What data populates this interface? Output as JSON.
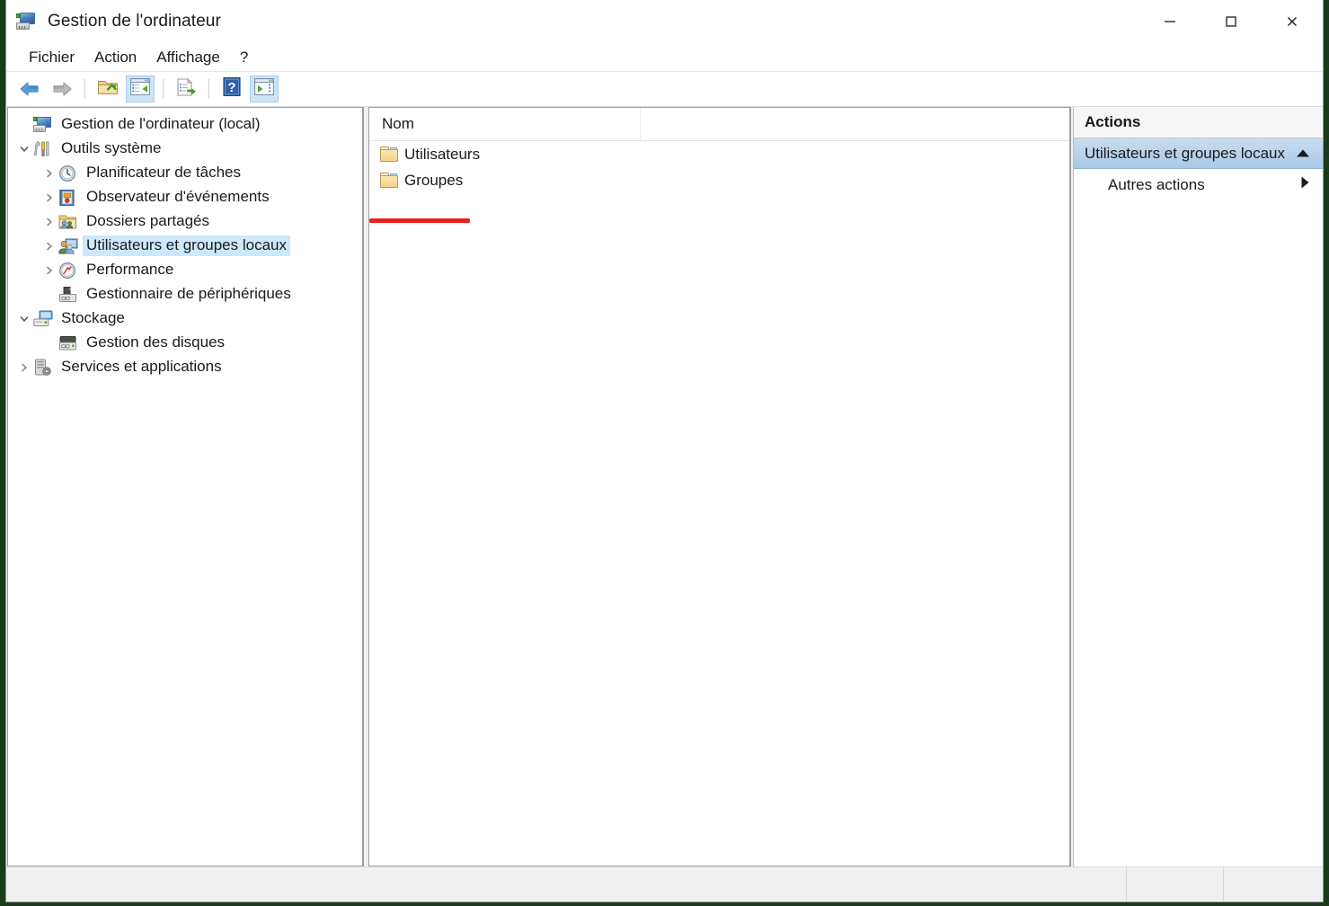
{
  "window": {
    "title": "Gestion de l'ordinateur",
    "icon": "computer-management-icon",
    "controls": {
      "minimize": "Réduire",
      "maximize": "Agrandir",
      "close": "Fermer"
    }
  },
  "menubar": {
    "items": [
      {
        "label": "Fichier",
        "name": "menu-fichier"
      },
      {
        "label": "Action",
        "name": "menu-action"
      },
      {
        "label": "Affichage",
        "name": "menu-affichage"
      },
      {
        "label": "?",
        "name": "menu-aide"
      }
    ]
  },
  "toolbar": {
    "buttons": [
      {
        "name": "back-button",
        "icon": "back-arrow-icon",
        "active": false
      },
      {
        "name": "forward-button",
        "icon": "forward-arrow-icon",
        "active": false
      },
      {
        "name": "up-one-level-button",
        "icon": "folder-up-icon",
        "active": false
      },
      {
        "name": "show-hide-console-tree-button",
        "icon": "console-tree-icon",
        "active": true
      },
      {
        "name": "export-list-button",
        "icon": "export-list-icon",
        "active": false
      },
      {
        "name": "help-button",
        "icon": "help-question-icon",
        "active": false
      },
      {
        "name": "show-hide-action-pane-button",
        "icon": "action-pane-icon",
        "active": true
      }
    ]
  },
  "tree": {
    "items": [
      {
        "label": "Gestion de l'ordinateur (local)",
        "icon": "computer-icon",
        "level": 0,
        "twisty": "none",
        "selected": false
      },
      {
        "label": "Outils système",
        "icon": "system-tools-icon",
        "level": 1,
        "twisty": "expanded",
        "selected": false
      },
      {
        "label": "Planificateur de tâches",
        "icon": "clock-icon",
        "level": 2,
        "twisty": "collapsed",
        "selected": false
      },
      {
        "label": "Observateur d'événements",
        "icon": "event-viewer-icon",
        "level": 2,
        "twisty": "collapsed",
        "selected": false
      },
      {
        "label": "Dossiers partagés",
        "icon": "shared-folders-icon",
        "level": 2,
        "twisty": "collapsed",
        "selected": false
      },
      {
        "label": "Utilisateurs et groupes locaux",
        "icon": "local-users-groups-icon",
        "level": 2,
        "twisty": "collapsed",
        "selected": true
      },
      {
        "label": "Performance",
        "icon": "performance-icon",
        "level": 2,
        "twisty": "collapsed",
        "selected": false
      },
      {
        "label": "Gestionnaire de périphériques",
        "icon": "device-manager-icon",
        "level": 2,
        "twisty": "none",
        "selected": false
      },
      {
        "label": "Stockage",
        "icon": "storage-icon",
        "level": 1,
        "twisty": "expanded",
        "selected": false
      },
      {
        "label": "Gestion des disques",
        "icon": "disk-management-icon",
        "level": 2,
        "twisty": "none",
        "selected": false
      },
      {
        "label": "Services et applications",
        "icon": "services-apps-icon",
        "level": 1,
        "twisty": "collapsed",
        "selected": false
      }
    ]
  },
  "list": {
    "columns": [
      "Nom"
    ],
    "rows": [
      {
        "name": "Utilisateurs",
        "icon": "folder-icon"
      },
      {
        "name": "Groupes",
        "icon": "folder-icon"
      }
    ],
    "annotation": {
      "type": "red-underline",
      "target": "Groupes",
      "color": "#e8211c"
    }
  },
  "actions": {
    "title": "Actions",
    "groups": [
      {
        "header": "Utilisateurs et groupes locaux",
        "collapse_icon": "chevron-up-icon",
        "items": [
          {
            "label": "Autres actions",
            "submenu_icon": "chevron-right-icon"
          }
        ]
      }
    ]
  },
  "statusbar": {
    "text": ""
  },
  "colors": {
    "selection": "#cce8ff",
    "action_header_top": "#c8ddf0",
    "action_header_bottom": "#a9c9e6",
    "annotation_red": "#e8211c",
    "toolbar_active": "#cce4f7",
    "window_bg": "#ffffff",
    "pane_bg": "#f0f0f0"
  }
}
